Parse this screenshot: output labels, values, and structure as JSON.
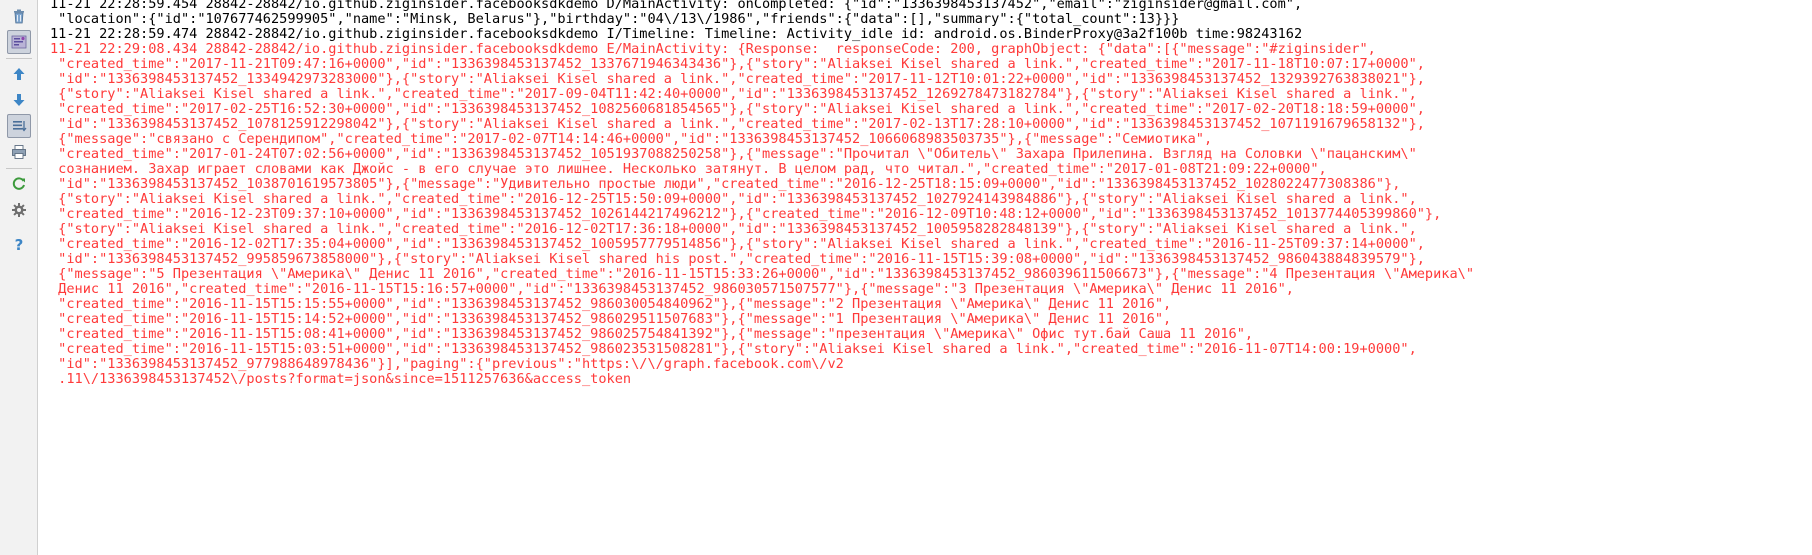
{
  "toolbar": {
    "buttons": [
      {
        "name": "clear-log-button",
        "icon": "trash-icon"
      },
      {
        "name": "soft-wraps-button",
        "icon": "soft-wrap-icon",
        "pressed": true
      },
      {
        "name": "previous-occurrence-button",
        "icon": "arrow-up-icon"
      },
      {
        "name": "next-occurrence-button",
        "icon": "arrow-down-icon"
      },
      {
        "name": "scroll-to-end-button",
        "icon": "scroll-to-end-icon",
        "pressed": true
      },
      {
        "name": "print-button",
        "icon": "printer-icon"
      },
      {
        "name": "restart-button",
        "icon": "restart-icon"
      },
      {
        "name": "settings-button",
        "icon": "gear-icon"
      },
      {
        "name": "help-button",
        "icon": "help-icon"
      }
    ]
  },
  "log": {
    "lines": [
      {
        "level": "debug",
        "text": "11-21 22:28:59.454 28842-28842/io.github.ziginsider.facebooksdkdemo D/MainActivity: onCompleted: {\"id\":\"1336398453137452\",\"email\":\"ziginsider@gmail.com\","
      },
      {
        "level": "debug",
        "text": " \"location\":{\"id\":\"107677462599905\",\"name\":\"Minsk, Belarus\"},\"birthday\":\"04\\/13\\/1986\",\"friends\":{\"data\":[],\"summary\":{\"total_count\":13}}}"
      },
      {
        "level": "info",
        "text": "11-21 22:28:59.474 28842-28842/io.github.ziginsider.facebooksdkdemo I/Timeline: Timeline: Activity_idle id: android.os.BinderProxy@3a2f100b time:98243162"
      },
      {
        "level": "error",
        "text": "11-21 22:29:08.434 28842-28842/io.github.ziginsider.facebooksdkdemo E/MainActivity: {Response:  responseCode: 200, graphObject: {\"data\":[{\"message\":\"#ziginsider\","
      },
      {
        "level": "error",
        "text": " \"created_time\":\"2017-11-21T09:47:16+0000\",\"id\":\"1336398453137452_1337671946343436\"},{\"story\":\"Aliaksei Kisel shared a link.\",\"created_time\":\"2017-11-18T10:07:17+0000\","
      },
      {
        "level": "error",
        "text": " \"id\":\"1336398453137452_1334942973283000\"},{\"story\":\"Aliaksei Kisel shared a link.\",\"created_time\":\"2017-11-12T10:01:22+0000\",\"id\":\"1336398453137452_1329392763838021\"},"
      },
      {
        "level": "error",
        "text": " {\"story\":\"Aliaksei Kisel shared a link.\",\"created_time\":\"2017-09-04T11:42:40+0000\",\"id\":\"1336398453137452_1269278473182784\"},{\"story\":\"Aliaksei Kisel shared a link.\","
      },
      {
        "level": "error",
        "text": " \"created_time\":\"2017-02-25T16:52:30+0000\",\"id\":\"1336398453137452_1082560681854565\"},{\"story\":\"Aliaksei Kisel shared a link.\",\"created_time\":\"2017-02-20T18:18:59+0000\","
      },
      {
        "level": "error",
        "text": " \"id\":\"1336398453137452_1078125912298042\"},{\"story\":\"Aliaksei Kisel shared a link.\",\"created_time\":\"2017-02-13T17:28:10+0000\",\"id\":\"1336398453137452_1071191679658132\"},"
      },
      {
        "level": "error",
        "text": " {\"message\":\"связано с Серендипом\",\"created_time\":\"2017-02-07T14:14:46+0000\",\"id\":\"1336398453137452_1066068983503735\"},{\"message\":\"Семиотика\","
      },
      {
        "level": "error",
        "text": " \"created_time\":\"2017-01-24T07:02:56+0000\",\"id\":\"1336398453137452_1051937088250258\"},{\"message\":\"Прочитал \\\"Обитель\\\" Захара Прилепина. Взгляд на Соловки \\\"пацанским\\\""
      },
      {
        "level": "error",
        "text": " сознанием. Захар играет словами как Джойс - в его случае это лишнее. Несколько затянут. В целом рад, что читал.\",\"created_time\":\"2017-01-08T21:09:22+0000\","
      },
      {
        "level": "error",
        "text": " \"id\":\"1336398453137452_1038701619573805\"},{\"message\":\"Удивительно простые люди\",\"created_time\":\"2016-12-25T18:15:09+0000\",\"id\":\"1336398453137452_1028022477308386\"},"
      },
      {
        "level": "error",
        "text": " {\"story\":\"Aliaksei Kisel shared a link.\",\"created_time\":\"2016-12-25T15:50:09+0000\",\"id\":\"1336398453137452_1027924143984886\"},{\"story\":\"Aliaksei Kisel shared a link.\","
      },
      {
        "level": "error",
        "text": " \"created_time\":\"2016-12-23T09:37:10+0000\",\"id\":\"1336398453137452_1026144217496212\"},{\"created_time\":\"2016-12-09T10:48:12+0000\",\"id\":\"1336398453137452_1013774405399860\"},"
      },
      {
        "level": "error",
        "text": " {\"story\":\"Aliaksei Kisel shared a link.\",\"created_time\":\"2016-12-02T17:36:18+0000\",\"id\":\"1336398453137452_1005958282848139\"},{\"story\":\"Aliaksei Kisel shared a link.\","
      },
      {
        "level": "error",
        "text": " \"created_time\":\"2016-12-02T17:35:04+0000\",\"id\":\"1336398453137452_1005957779514856\"},{\"story\":\"Aliaksei Kisel shared a link.\",\"created_time\":\"2016-11-25T09:37:14+0000\","
      },
      {
        "level": "error",
        "text": " \"id\":\"1336398453137452_995859673858000\"},{\"story\":\"Aliaksei Kisel shared his post.\",\"created_time\":\"2016-11-15T15:39:08+0000\",\"id\":\"1336398453137452_986043884839579\"},"
      },
      {
        "level": "error",
        "text": " {\"message\":\"5 Презентация \\\"Америка\\\" Денис 11 2016\",\"created_time\":\"2016-11-15T15:33:26+0000\",\"id\":\"1336398453137452_986039611506673\"},{\"message\":\"4 Презентация \\\"Америка\\\""
      },
      {
        "level": "error",
        "text": " Денис 11 2016\",\"created_time\":\"2016-11-15T15:16:57+0000\",\"id\":\"1336398453137452_986030571507577\"},{\"message\":\"3 Презентация \\\"Америка\\\" Денис 11 2016\","
      },
      {
        "level": "error",
        "text": " \"created_time\":\"2016-11-15T15:15:55+0000\",\"id\":\"1336398453137452_986030054840962\"},{\"message\":\"2 Презентация \\\"Америка\\\" Денис 11 2016\","
      },
      {
        "level": "error",
        "text": " \"created_time\":\"2016-11-15T15:14:52+0000\",\"id\":\"1336398453137452_986029511507683\"},{\"message\":\"1 Презентация \\\"Америка\\\" Денис 11 2016\","
      },
      {
        "level": "error",
        "text": " \"created_time\":\"2016-11-15T15:08:41+0000\",\"id\":\"1336398453137452_986025754841392\"},{\"message\":\"презентация \\\"Америка\\\" Офис тут.бай Саша 11 2016\","
      },
      {
        "level": "error",
        "text": " \"created_time\":\"2016-11-15T15:03:51+0000\",\"id\":\"1336398453137452_986023531508281\"},{\"story\":\"Aliaksei Kisel shared a link.\",\"created_time\":\"2016-11-07T14:00:19+0000\","
      },
      {
        "level": "error",
        "text": " \"id\":\"1336398453137452_977988648978436\"}],\"paging\":{\"previous\":\"https:\\/\\/graph.facebook.com\\/v2"
      },
      {
        "level": "error",
        "text": " .11\\/1336398453137452\\/posts?format=json&since=1511257636&access_token"
      }
    ]
  },
  "colors": {
    "error": "#ff3a3a",
    "normal": "#000000",
    "toolbar_bg": "#f2f2f2"
  }
}
